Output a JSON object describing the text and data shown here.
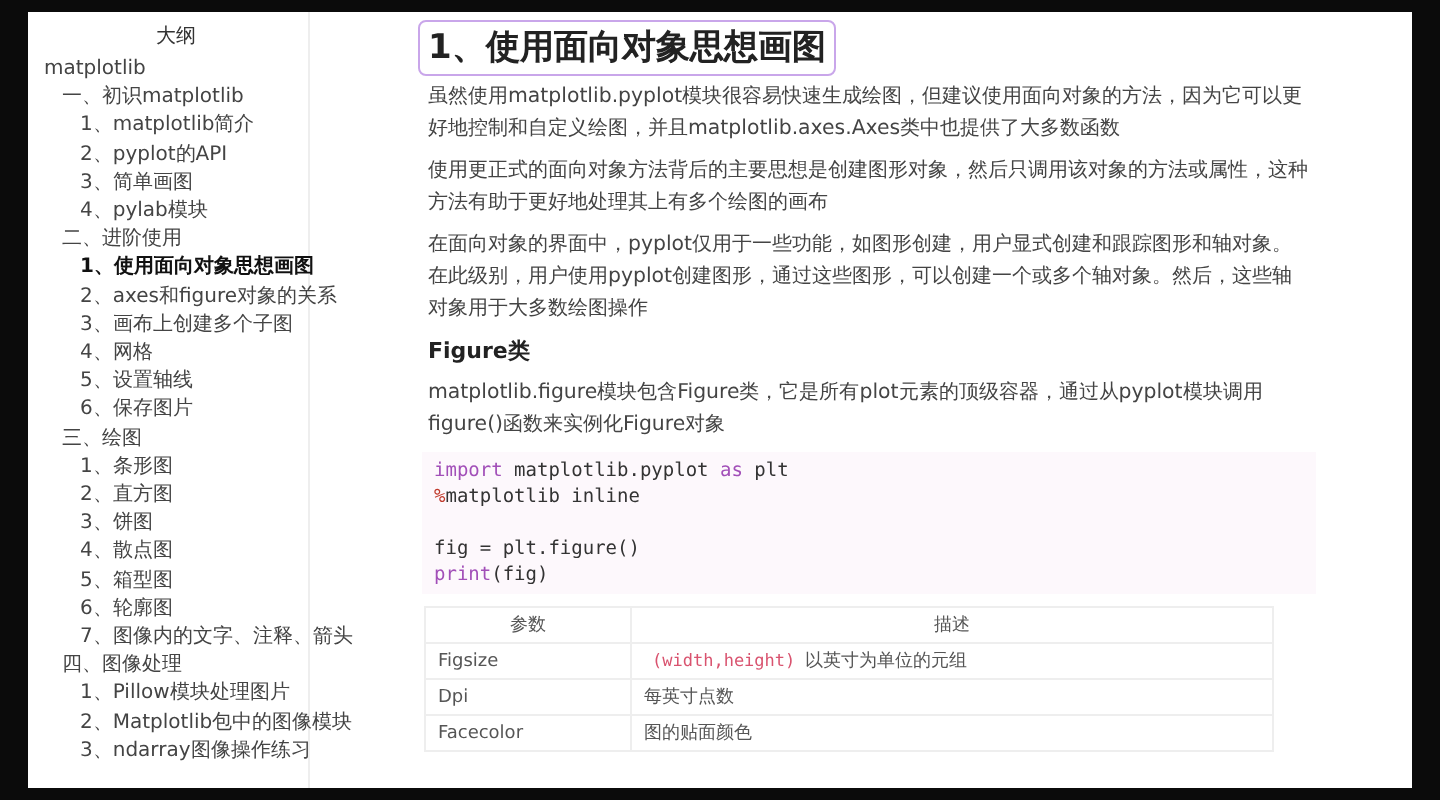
{
  "sidebar": {
    "title": "大纲",
    "items": [
      {
        "label": "matplotlib",
        "selected": false,
        "children": [
          {
            "label": "一、初识matplotlib",
            "selected": false,
            "children": [
              {
                "label": "1、matplotlib简介",
                "selected": false
              },
              {
                "label": "2、pyplot的API",
                "selected": false
              },
              {
                "label": "3、简单画图",
                "selected": false
              },
              {
                "label": "4、pylab模块",
                "selected": false
              }
            ]
          },
          {
            "label": "二、进阶使用",
            "selected": false,
            "children": [
              {
                "label": "1、使用面向对象思想画图",
                "selected": true
              },
              {
                "label": "2、axes和figure对象的关系",
                "selected": false
              },
              {
                "label": "3、画布上创建多个子图",
                "selected": false
              },
              {
                "label": "4、网格",
                "selected": false
              },
              {
                "label": "5、设置轴线",
                "selected": false
              },
              {
                "label": "6、保存图片",
                "selected": false
              }
            ]
          },
          {
            "label": "三、绘图",
            "selected": false,
            "children": [
              {
                "label": "1、条形图",
                "selected": false
              },
              {
                "label": "2、直方图",
                "selected": false
              },
              {
                "label": "3、饼图",
                "selected": false
              },
              {
                "label": "4、散点图",
                "selected": false
              },
              {
                "label": "5、箱型图",
                "selected": false
              },
              {
                "label": "6、轮廓图",
                "selected": false
              },
              {
                "label": "7、图像内的文字、注释、箭头",
                "selected": false
              }
            ]
          },
          {
            "label": "四、图像处理",
            "selected": false,
            "children": [
              {
                "label": "1、Pillow模块处理图片",
                "selected": false
              },
              {
                "label": "2、Matplotlib包中的图像模块",
                "selected": false
              },
              {
                "label": "3、ndarray图像操作练习",
                "selected": false
              }
            ]
          }
        ]
      }
    ]
  },
  "article": {
    "heading": {
      "text": "1、使用面向对象思想画图",
      "highlighted": true
    },
    "blocks": [
      {
        "kind": "paragraph",
        "text": "虽然使用matplotlib.pyplot模块很容易快速生成绘图，但建议使用面向对象的方法，因为它可以更好地控制和自定义绘图，并且matplotlib.axes.Axes类中也提供了大多数函数"
      },
      {
        "kind": "paragraph",
        "text": "使用更正式的面向对象方法背后的主要思想是创建图形对象，然后只调用该对象的方法或属性，这种方法有助于更好地处理其上有多个绘图的画布"
      },
      {
        "kind": "paragraph",
        "text": "在面向对象的界面中，pyplot仅用于一些功能，如图形创建，用户显式创建和跟踪图形和轴对象。在此级别，用户使用pyplot创建图形，通过这些图形，可以创建一个或多个轴对象。然后，这些轴对象用于大多数绘图操作"
      },
      {
        "kind": "subheading",
        "text": "Figure类"
      },
      {
        "kind": "paragraph",
        "text": "matplotlib.figure模块包含Figure类，它是所有plot元素的顶级容器，通过从pyplot模块调用figure()函数来实例化Figure对象"
      },
      {
        "kind": "code",
        "lines": [
          {
            "kind": "code",
            "tokens": [
              {
                "text": "import",
                "kind": "keyword"
              },
              {
                "text": " matplotlib.pyplot ",
                "kind": "plain"
              },
              {
                "text": "as",
                "kind": "keyword"
              },
              {
                "text": " plt",
                "kind": "plain"
              }
            ]
          },
          {
            "kind": "code",
            "tokens": [
              {
                "text": "%",
                "kind": "magic"
              },
              {
                "text": "matplotlib inline",
                "kind": "plain"
              }
            ]
          },
          {
            "kind": "blank"
          },
          {
            "kind": "code",
            "tokens": [
              {
                "text": "fig = plt.figure()",
                "kind": "plain"
              }
            ]
          },
          {
            "kind": "code",
            "tokens": [
              {
                "text": "print",
                "kind": "keyword"
              },
              {
                "text": "(fig)",
                "kind": "plain"
              }
            ]
          }
        ]
      },
      {
        "kind": "table",
        "columns": [
          "参数",
          "描述"
        ],
        "rows": [
          [
            {
              "text": "Figsize"
            },
            {
              "code": "(width,height)",
              "text": "以英寸为单位的元组"
            }
          ],
          [
            {
              "text": "Dpi"
            },
            {
              "text": "每英寸点数"
            }
          ],
          [
            {
              "text": "Facecolor"
            },
            {
              "text": "图的贴面颜色"
            }
          ]
        ]
      }
    ]
  }
}
